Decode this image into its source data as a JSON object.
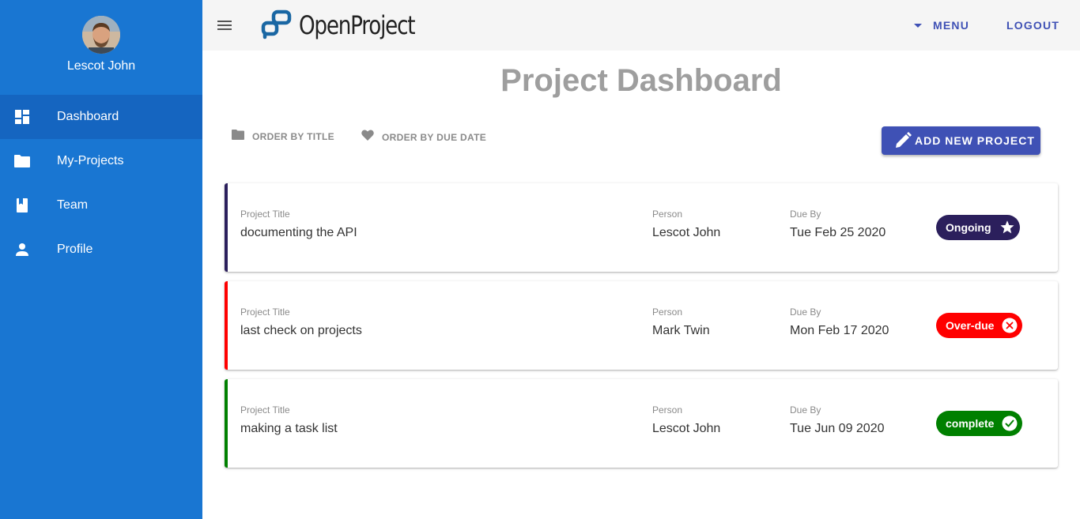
{
  "sidebar": {
    "user_name": "Lescot John",
    "items": [
      {
        "label": "Dashboard",
        "icon": "dashboard-icon",
        "active": true
      },
      {
        "label": "My-Projects",
        "icon": "folder-icon"
      },
      {
        "label": "Team",
        "icon": "book-icon"
      },
      {
        "label": "Profile",
        "icon": "person-icon"
      }
    ]
  },
  "header": {
    "logo_text": "OpenProject",
    "menu_label": "MENU",
    "logout_label": "LOGOUT"
  },
  "main": {
    "title": "Project Dashboard",
    "order_by_title": "ORDER BY TITLE",
    "order_by_due_date": "ORDER BY DUE DATE",
    "add_button": "ADD NEW PROJECT",
    "labels": {
      "title": "Project Title",
      "person": "Person",
      "due": "Due By"
    },
    "projects": [
      {
        "title": "documenting the API",
        "person": "Lescot John",
        "due": "Tue Feb 25 2020",
        "status": "Ongoing",
        "status_icon": "star-icon",
        "color": "#2b1f5c"
      },
      {
        "title": "last check on projects",
        "person": "Mark Twin",
        "due": "Mon Feb 17 2020",
        "status": "Over-due",
        "status_icon": "cancel-icon",
        "color": "#ff0000"
      },
      {
        "title": "making a task list",
        "person": "Lescot John",
        "due": "Tue Jun 09 2020",
        "status": "complete",
        "status_icon": "check-circle-icon",
        "color": "#008000"
      }
    ]
  },
  "colors": {
    "sidebar": "#1976d2",
    "sidebar_active": "#1565c0",
    "accent": "#3f51b5",
    "topbar": "#f5f5f5"
  }
}
